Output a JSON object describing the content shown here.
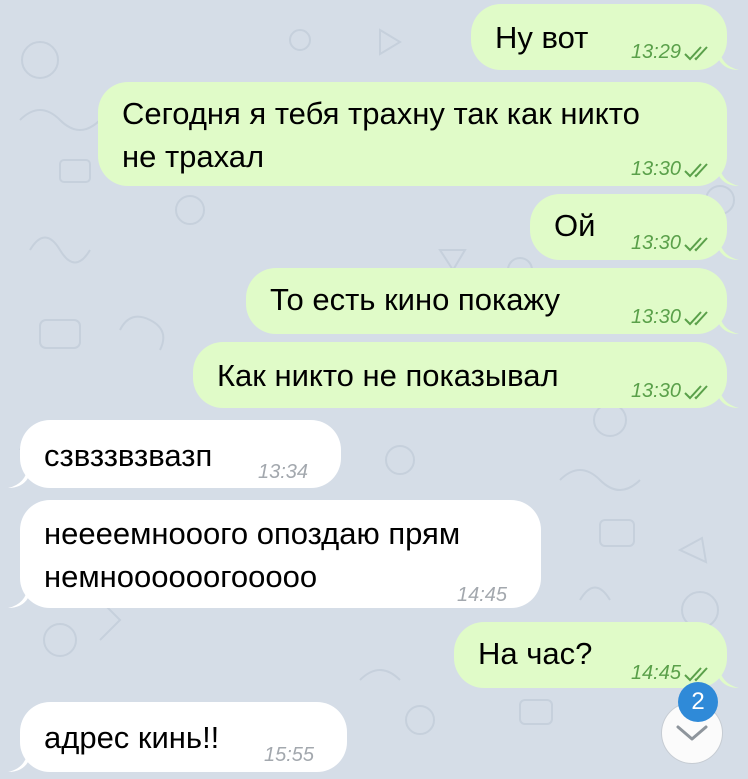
{
  "messages": [
    {
      "dir": "out",
      "text": "Ну вот",
      "time": "13:29"
    },
    {
      "dir": "out",
      "text": "Сегодня я тебя трахну так как никто\nне трахал",
      "time": "13:30"
    },
    {
      "dir": "out",
      "text": "Ой",
      "time": "13:30"
    },
    {
      "dir": "out",
      "text": "То есть кино покажу",
      "time": "13:30"
    },
    {
      "dir": "out",
      "text": "Как никто не показывал",
      "time": "13:30"
    },
    {
      "dir": "in",
      "text": "сзвззвзвазп",
      "time": "13:34"
    },
    {
      "dir": "in",
      "text": "неееемнооого опоздаю прям\nнемноооооогооооо",
      "time": "14:45"
    },
    {
      "dir": "out",
      "text": "На час?",
      "time": "14:45"
    },
    {
      "dir": "in",
      "text": "адрес кинь!!",
      "time": "15:55"
    }
  ],
  "scroll_button": {
    "unread_badge": "2",
    "icon": "chevron-down-icon"
  },
  "colors": {
    "outgoing": "#e0fbc8",
    "incoming": "#ffffff",
    "wallpaper": "#d5dde7",
    "badge": "#2f8ad8",
    "read_checks": "#5aa04a"
  }
}
